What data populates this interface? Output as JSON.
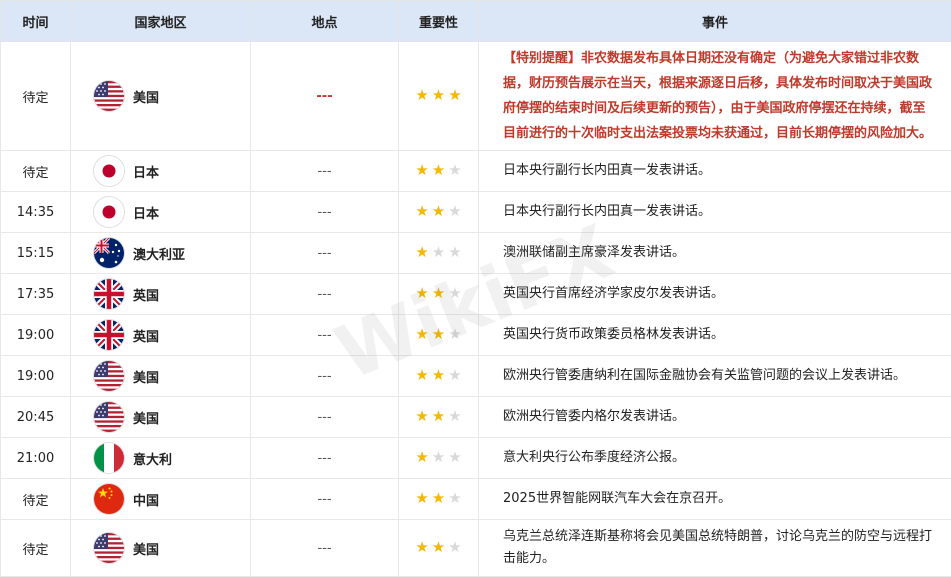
{
  "headers": [
    "时间",
    "国家地区",
    "地点",
    "重要性",
    "事件"
  ],
  "rows": [
    {
      "time": "待定",
      "flag": "us-flag-icon",
      "country": "美国",
      "location": "---",
      "stars": 3,
      "highlight": true,
      "event": "【特别提醒】非农数据发布具体日期还没有确定（为避免大家错过非农数据，财历预告展示在当天，根据来源逐日后移，具体发布时间取决于美国政府停摆的结束时间及后续更新的预告），由于美国政府停摆还在持续，截至目前进行的十次临时支出法案投票均未获通过，目前长期停摆的风险加大。"
    },
    {
      "time": "待定",
      "flag": "jp-flag-icon",
      "country": "日本",
      "location": "---",
      "stars": 2,
      "event": "日本央行副行长内田真一发表讲话。"
    },
    {
      "time": "14:35",
      "flag": "jp-flag-icon",
      "country": "日本",
      "location": "---",
      "stars": 2,
      "event": "日本央行副行长内田真一发表讲话。"
    },
    {
      "time": "15:15",
      "flag": "au-flag-icon",
      "country": "澳大利亚",
      "location": "---",
      "stars": 1,
      "event": "澳洲联储副主席豪泽发表讲话。"
    },
    {
      "time": "17:35",
      "flag": "uk-flag-icon",
      "country": "英国",
      "location": "---",
      "stars": 2,
      "event": "英国央行首席经济学家皮尔发表讲话。"
    },
    {
      "time": "19:00",
      "flag": "uk-flag-icon",
      "country": "英国",
      "location": "---",
      "stars": 2,
      "event": "英国央行货币政策委员格林发表讲话。"
    },
    {
      "time": "19:00",
      "flag": "us-flag-icon",
      "country": "美国",
      "location": "---",
      "stars": 2,
      "event": "欧洲央行管委唐纳利在国际金融协会有关监管问题的会议上发表讲话。"
    },
    {
      "time": "20:45",
      "flag": "us-flag-icon",
      "country": "美国",
      "location": "---",
      "stars": 2,
      "event": "欧洲央行管委内格尔发表讲话。"
    },
    {
      "time": "21:00",
      "flag": "it-flag-icon",
      "country": "意大利",
      "location": "---",
      "stars": 1,
      "event": "意大利央行公布季度经济公报。"
    },
    {
      "time": "待定",
      "flag": "cn-flag-icon",
      "country": "中国",
      "location": "---",
      "stars": 2,
      "event": "2025世界智能网联汽车大会在京召开。"
    },
    {
      "time": "待定",
      "flag": "us-flag-icon",
      "country": "美国",
      "location": "---",
      "stars": 2,
      "event": "乌克兰总统泽连斯基称将会见美国总统特朗普，讨论乌克兰的防空与远程打击能力。"
    }
  ],
  "watermark": "WikiFX",
  "colors": {
    "header_bg": "#dbe6f6",
    "highlight_text": "#c0392b",
    "star_on": "#f5b800",
    "star_off": "#d9d9d9"
  }
}
